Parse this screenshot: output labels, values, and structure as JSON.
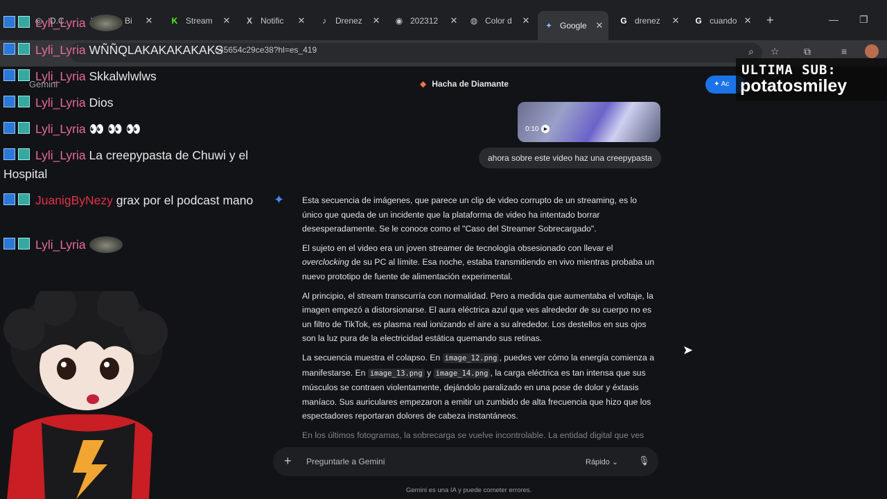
{
  "browser": {
    "tabs": [
      {
        "title": "D.C.",
        "icon": "discord-icon",
        "active": false
      },
      {
        "title": "Bi",
        "icon": "tab-icon",
        "active": false
      },
      {
        "title": "Stream",
        "icon": "kick-icon",
        "active": false
      },
      {
        "title": "Notific",
        "icon": "x-icon",
        "active": false
      },
      {
        "title": "Drenez",
        "icon": "tiktok-icon",
        "active": false
      },
      {
        "title": "202312",
        "icon": "globe-icon",
        "active": false
      },
      {
        "title": "Color d",
        "icon": "color-icon",
        "active": false
      },
      {
        "title": "Google",
        "icon": "gemini-icon",
        "active": true
      },
      {
        "title": "drenez",
        "icon": "google-icon",
        "active": false
      },
      {
        "title": "cuando",
        "icon": "google-icon",
        "active": false
      }
    ],
    "url": "c45654c29ce38?hl=es_419"
  },
  "gemini": {
    "app_label": "Gemini",
    "chat_title": "Hacha de Diamante",
    "share_label": "Ac",
    "video_duration": "0:10",
    "user_prompt": "ahora sobre este video haz una creepypasta",
    "response": [
      "Esta secuencia de imágenes, que parece un clip de video corrupto de un streaming, es lo único que queda de un incidente que la plataforma de video ha intentado borrar desesperadamente. Se le conoce como el \"Caso del Streamer Sobrecargado\".",
      "El sujeto en el video era un joven streamer de tecnología obsesionado con llevar el",
      "overclocking",
      "de su PC al límite. Esa noche, estaba transmitiendo en vivo mientras probaba un nuevo prototipo de fuente de alimentación experimental.",
      "Al principio, el stream transcurría con normalidad. Pero a medida que aumentaba el voltaje, la imagen empezó a distorsionarse. El aura eléctrica azul que ves alrededor de su cuerpo no es un filtro de TikTok, es plasma real ionizando el aire a su alrededor. Los destellos en sus ojos son la luz pura de la electricidad estática quemando sus retinas.",
      "La secuencia muestra el colapso. En",
      "image_12.png",
      ", puedes ver cómo la energía comienza a manifestarse. En",
      "image_13.png",
      "y",
      "image_14.png",
      ", la carga eléctrica es tan intensa que sus músculos se contraen violentamente, dejándolo paralizado en una pose de dolor y éxtasis maníaco. Sus auriculares empezaron a emitir un zumbido de alta frecuencia que hizo que los espectadores reportaran dolores de cabeza instantáneos.",
      "En los últimos fotogramas, la sobrecarga se vuelve incontrolable. La entidad digital que ves"
    ],
    "input_placeholder": "Preguntarle a Gemini",
    "mode": "Rápido",
    "disclaimer": "Gemini es una IA y puede cometer errores."
  },
  "stream_chat": {
    "messages": [
      {
        "user": "Lyli_Lyria",
        "text": "",
        "user_color": "#e86a9a",
        "emote": true
      },
      {
        "user": "Lyli_Lyria",
        "text": "WÑÑQLAKAKAKAKAKS",
        "user_color": "#e86a9a",
        "emote": false
      },
      {
        "user": "Lyli_Lyria",
        "text": "Skkalwlwlws",
        "user_color": "#e86a9a",
        "emote": false
      },
      {
        "user": "Lyli_Lyria",
        "text": "Dios",
        "user_color": "#e86a9a",
        "emote": false
      },
      {
        "user": "Lyli_Lyria",
        "text": "👀 👀 👀",
        "user_color": "#e86a9a",
        "emote": false
      },
      {
        "user": "Lyli_Lyria",
        "text": "La creepypasta de Chuwi y el Hospital",
        "user_color": "#e86a9a",
        "emote": false
      },
      {
        "user": "JuanigByNezy",
        "text": "grax por el podcast mano",
        "user_color": "#e0304a",
        "emote": false
      },
      {
        "user": "Lyli_Lyria",
        "text": "",
        "user_color": "#e86a9a",
        "emote": true
      }
    ]
  },
  "sub_overlay": {
    "title": "ULTIMA SUB:",
    "name": "potatosmiley"
  }
}
